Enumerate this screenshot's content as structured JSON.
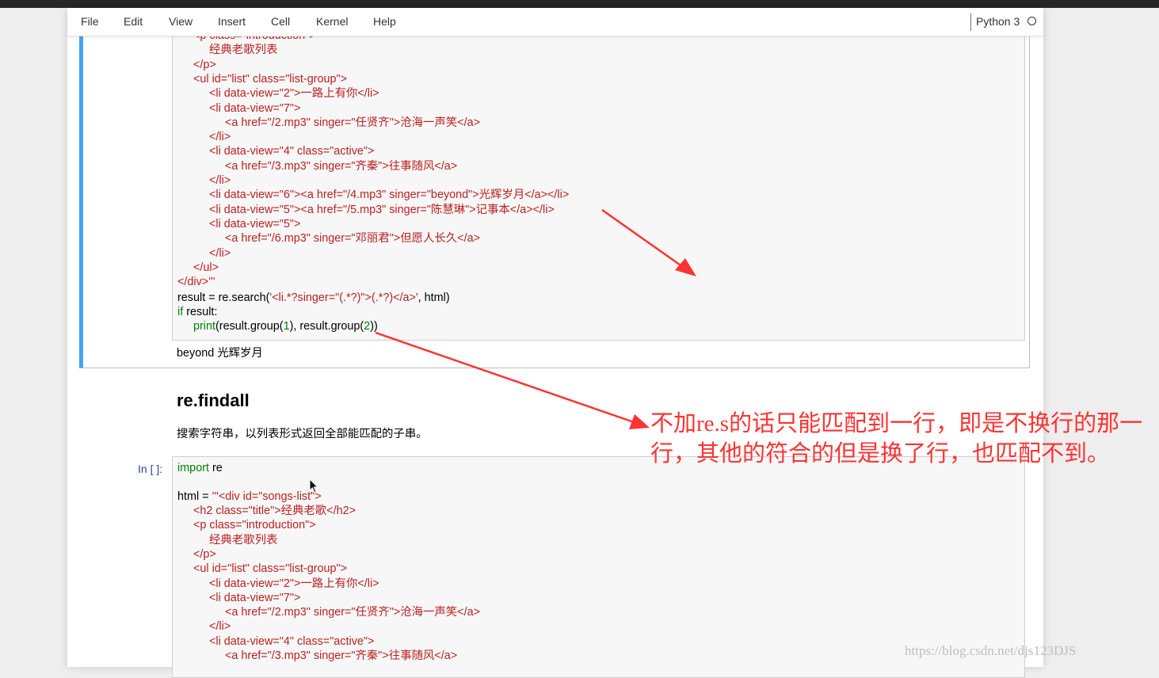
{
  "menu": {
    "file": "File",
    "edit": "Edit",
    "view": "View",
    "insert": "Insert",
    "cell": "Cell",
    "kernel": "Kernel",
    "help": "Help"
  },
  "kernel": {
    "name": "Python 3"
  },
  "cell1": {
    "lines": [
      "<p class=\"introduction\">",
      "经典老歌列表",
      "</p>",
      "<ul id=\"list\" class=\"list-group\">",
      "<li data-view=\"2\">一路上有你</li>",
      "<li data-view=\"7\">",
      "<a href=\"/2.mp3\" singer=\"任贤齐\">沧海一声笑</a>",
      "</li>",
      "<li data-view=\"4\" class=\"active\">",
      "<a href=\"/3.mp3\" singer=\"齐秦\">往事随风</a>",
      "</li>",
      "<li data-view=\"6\"><a href=\"/4.mp3\" singer=\"beyond\">光辉岁月</a></li>",
      "<li data-view=\"5\"><a href=\"/5.mp3\" singer=\"陈慧琳\">记事本</a></li>",
      "<li data-view=\"5\">",
      "<a href=\"/6.mp3\" singer=\"邓丽君\">但愿人长久</a>",
      "</li>",
      "</ul>",
      "</div>'''"
    ],
    "search_prefix": "result = re.search(",
    "search_pattern": "'<li.*?singer=\"(.*?)\">(.*?)</a>'",
    "search_suffix": ", html)",
    "if_kw": "if",
    "if_rest": " result:",
    "print_kw": "print",
    "print_a": "(result.group(",
    "print_n1": "1",
    "print_b": "), result.group(",
    "print_n2": "2",
    "print_c": "))",
    "output": "beyond 光辉岁月"
  },
  "markdown": {
    "heading": "re.findall",
    "paragraph": "搜索字符串，以列表形式返回全部能匹配的子串。"
  },
  "cell2": {
    "prompt": "In [ ]:",
    "import_kw": "import",
    "import_rest": " re",
    "html_prefix": "html = ",
    "html_start": "'''<div id=\"songs-list\">",
    "lines": [
      "<h2 class=\"title\">经典老歌</h2>",
      "<p class=\"introduction\">",
      "经典老歌列表",
      "</p>",
      "<ul id=\"list\" class=\"list-group\">",
      "<li data-view=\"2\">一路上有你</li>",
      "<li data-view=\"7\">",
      "<a href=\"/2.mp3\" singer=\"任贤齐\">沧海一声笑</a>",
      "</li>",
      "<li data-view=\"4\" class=\"active\">",
      "<a href=\"/3.mp3\" singer=\"齐秦\">往事随风</a>"
    ]
  },
  "annotation": "不加re.s的话只能匹配到一行，即是不换行的那一行，其他的符合的但是换了行，也匹配不到。",
  "watermark": "https://blog.csdn.net/djs123DJS",
  "colors": {
    "selection_bar": "#42a5f5",
    "string": "#ba2121",
    "keyword": "#008000",
    "annotation": "#ff3333",
    "prompt": "#303f9f"
  }
}
